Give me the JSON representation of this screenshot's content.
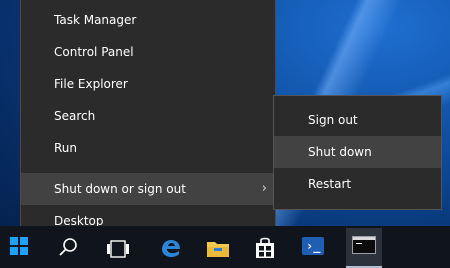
{
  "context_menu": {
    "items": [
      {
        "label": "Task Manager"
      },
      {
        "label": "Control Panel"
      },
      {
        "label": "File Explorer"
      },
      {
        "label": "Search"
      },
      {
        "label": "Run"
      },
      {
        "label": "Shut down or sign out",
        "has_submenu": true
      },
      {
        "label": "Desktop"
      }
    ],
    "submenu_chevron": "›"
  },
  "submenu": {
    "items": [
      {
        "label": "Sign out"
      },
      {
        "label": "Shut down"
      },
      {
        "label": "Restart"
      }
    ]
  },
  "taskbar": {
    "icons": [
      "windows-start-icon",
      "search-icon",
      "task-view-icon",
      "edge-icon",
      "file-explorer-icon",
      "store-icon",
      "powershell-icon",
      "command-prompt-icon"
    ],
    "powershell_glyph": "›_",
    "colors": {
      "accent": "#1ea0ff",
      "taskbar_bg": "#10141c",
      "menu_bg": "#2b2b2b",
      "highlight": "#424242"
    }
  }
}
